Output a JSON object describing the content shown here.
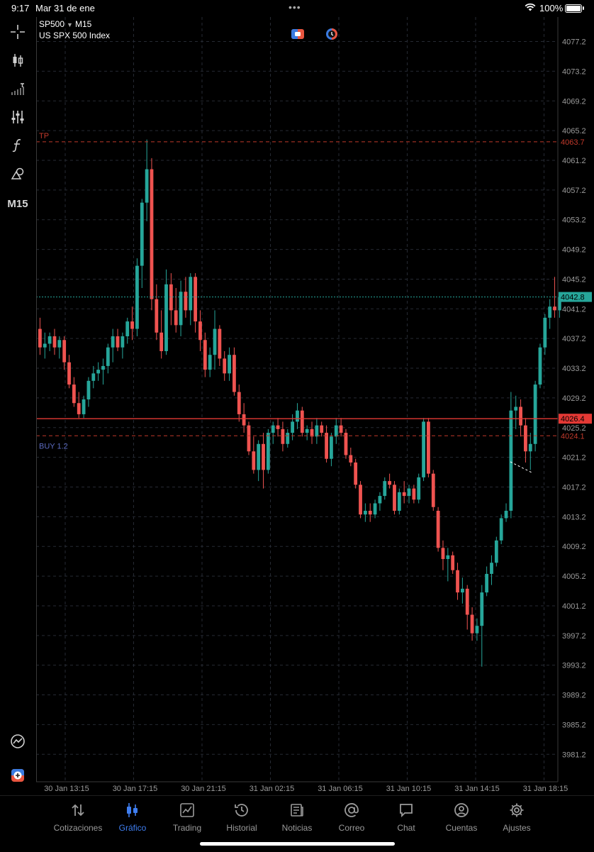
{
  "status_bar": {
    "time": "9:17",
    "date": "Mar 31 de ene",
    "battery": "100%"
  },
  "chart_header": {
    "symbol": "SP500",
    "timeframe": "M15",
    "description": "US SPX 500 Index"
  },
  "left_toolbar": {
    "items": [
      {
        "icon": "crosshair-icon"
      },
      {
        "icon": "candles-icon"
      },
      {
        "icon": "indicators-icon"
      },
      {
        "icon": "settings-sliders-icon"
      },
      {
        "icon": "function-icon"
      },
      {
        "icon": "objects-icon"
      }
    ],
    "timeframe_label": "M15"
  },
  "colors": {
    "bull": "#26a69a",
    "bear": "#ef5350",
    "grid": "#2a2a2a",
    "tab_active": "#3f7ef0",
    "tp": "#c0392b",
    "buy": "#5c6bc0"
  },
  "chart_data": {
    "type": "candlestick",
    "ylim": [
      3977.5,
      4080.5
    ],
    "y_ticks": [
      "4077.2",
      "4073.2",
      "4069.2",
      "4065.2",
      "4061.2",
      "4057.2",
      "4053.2",
      "4049.2",
      "4045.2",
      "4041.2",
      "4037.2",
      "4033.2",
      "4029.2",
      "4025.2",
      "4021.2",
      "4017.2",
      "4013.2",
      "4009.2",
      "4005.2",
      "4001.2",
      "3997.2",
      "3993.2",
      "3989.2",
      "3985.2",
      "3981.2"
    ],
    "x_ticks": [
      "30 Jan 13:15",
      "30 Jan 17:15",
      "30 Jan 21:15",
      "31 Jan 02:15",
      "31 Jan 06:15",
      "31 Jan 10:15",
      "31 Jan 14:15",
      "31 Jan 18:15"
    ],
    "levels": [
      {
        "label": "TP",
        "price": 4063.7,
        "price_label": "4063.7",
        "style": "dashed",
        "color": "#c0392b"
      },
      {
        "label": "BUY 1.2",
        "price": 4024.1,
        "price_label": "4024.1",
        "style": "dashed",
        "color": "#c0392b"
      },
      {
        "label": "",
        "price": 4026.4,
        "price_label": "4026.4",
        "style": "solid",
        "color": "#e53935"
      },
      {
        "label": "",
        "price": 4042.8,
        "price_label": "4042.8",
        "style": "dotted",
        "color": "#26a69a"
      }
    ],
    "candles": [
      [
        4038.5,
        4040.0,
        4035.0,
        4036.0
      ],
      [
        4036.0,
        4038.0,
        4034.5,
        4036.5
      ],
      [
        4036.5,
        4038.0,
        4035.5,
        4037.5
      ],
      [
        4037.5,
        4038.5,
        4035.0,
        4036.0
      ],
      [
        4036.0,
        4037.5,
        4034.5,
        4037.0
      ],
      [
        4037.0,
        4037.5,
        4033.0,
        4034.0
      ],
      [
        4034.0,
        4035.0,
        4030.5,
        4031.0
      ],
      [
        4031.0,
        4032.0,
        4028.0,
        4028.5
      ],
      [
        4028.5,
        4030.0,
        4026.5,
        4027.0
      ],
      [
        4027.0,
        4029.5,
        4026.5,
        4029.0
      ],
      [
        4029.0,
        4032.0,
        4028.0,
        4031.5
      ],
      [
        4031.5,
        4033.5,
        4030.5,
        4032.5
      ],
      [
        4032.5,
        4034.0,
        4031.5,
        4033.0
      ],
      [
        4033.0,
        4034.5,
        4031.0,
        4033.5
      ],
      [
        4033.5,
        4036.5,
        4032.5,
        4036.0
      ],
      [
        4036.0,
        4038.5,
        4034.0,
        4037.5
      ],
      [
        4037.5,
        4038.5,
        4035.5,
        4036.0
      ],
      [
        4036.0,
        4038.0,
        4034.5,
        4037.5
      ],
      [
        4037.5,
        4040.0,
        4036.5,
        4039.5
      ],
      [
        4039.5,
        4041.5,
        4037.0,
        4038.5
      ],
      [
        4038.5,
        4048.0,
        4037.5,
        4047.0
      ],
      [
        4047.0,
        4056.0,
        4044.0,
        4055.5
      ],
      [
        4055.5,
        4064.0,
        4053.0,
        4060.0
      ],
      [
        4060.0,
        4061.5,
        4041.0,
        4042.5
      ],
      [
        4042.5,
        4044.5,
        4037.0,
        4038.0
      ],
      [
        4038.0,
        4041.0,
        4034.5,
        4035.5
      ],
      [
        4035.5,
        4046.5,
        4035.0,
        4044.5
      ],
      [
        4044.5,
        4046.0,
        4039.0,
        4041.0
      ],
      [
        4041.0,
        4044.0,
        4038.0,
        4039.0
      ],
      [
        4039.0,
        4045.0,
        4037.5,
        4043.5
      ],
      [
        4043.5,
        4045.5,
        4040.0,
        4041.0
      ],
      [
        4041.0,
        4046.0,
        4039.0,
        4045.5
      ],
      [
        4045.5,
        4046.0,
        4038.0,
        4039.5
      ],
      [
        4039.5,
        4041.0,
        4035.5,
        4037.0
      ],
      [
        4037.0,
        4038.0,
        4032.0,
        4033.0
      ],
      [
        4033.0,
        4036.0,
        4032.0,
        4035.0
      ],
      [
        4035.0,
        4041.0,
        4033.0,
        4038.5
      ],
      [
        4038.5,
        4039.0,
        4033.5,
        4034.5
      ],
      [
        4034.5,
        4035.5,
        4031.5,
        4032.5
      ],
      [
        4032.5,
        4036.0,
        4031.5,
        4035.0
      ],
      [
        4035.0,
        4036.0,
        4029.5,
        4030.0
      ],
      [
        4030.0,
        4031.0,
        4026.0,
        4027.0
      ],
      [
        4027.0,
        4028.5,
        4024.5,
        4025.5
      ],
      [
        4025.5,
        4026.0,
        4021.5,
        4022.0
      ],
      [
        4022.0,
        4024.0,
        4019.0,
        4019.5
      ],
      [
        4019.5,
        4023.5,
        4018.0,
        4023.0
      ],
      [
        4023.0,
        4024.5,
        4017.0,
        4019.5
      ],
      [
        4019.5,
        4025.0,
        4019.0,
        4024.5
      ],
      [
        4024.5,
        4026.0,
        4023.0,
        4025.5
      ],
      [
        4025.5,
        4026.5,
        4024.0,
        4025.0
      ],
      [
        4025.0,
        4026.0,
        4022.0,
        4023.0
      ],
      [
        4023.0,
        4025.0,
        4022.5,
        4024.5
      ],
      [
        4024.5,
        4027.0,
        4023.5,
        4026.0
      ],
      [
        4026.0,
        4028.5,
        4025.0,
        4027.5
      ],
      [
        4027.5,
        4028.0,
        4024.0,
        4024.5
      ],
      [
        4024.5,
        4025.5,
        4023.5,
        4025.0
      ],
      [
        4025.0,
        4026.0,
        4023.0,
        4024.0
      ],
      [
        4024.0,
        4026.5,
        4023.0,
        4025.5
      ],
      [
        4025.5,
        4026.0,
        4024.0,
        4024.5
      ],
      [
        4024.5,
        4025.5,
        4020.5,
        4021.0
      ],
      [
        4021.0,
        4024.5,
        4020.0,
        4024.0
      ],
      [
        4024.0,
        4026.5,
        4023.0,
        4025.5
      ],
      [
        4025.5,
        4026.5,
        4024.0,
        4024.5
      ],
      [
        4024.5,
        4025.0,
        4021.0,
        4021.5
      ],
      [
        4021.5,
        4022.5,
        4020.0,
        4020.5
      ],
      [
        4020.5,
        4021.0,
        4017.0,
        4017.5
      ],
      [
        4017.5,
        4018.0,
        4013.0,
        4013.5
      ],
      [
        4013.5,
        4015.0,
        4012.5,
        4014.0
      ],
      [
        4014.0,
        4015.0,
        4012.5,
        4013.5
      ],
      [
        4013.5,
        4015.5,
        4013.0,
        4015.0
      ],
      [
        4015.0,
        4016.5,
        4014.0,
        4016.0
      ],
      [
        4016.0,
        4018.5,
        4015.5,
        4018.0
      ],
      [
        4018.0,
        4019.0,
        4017.0,
        4017.5
      ],
      [
        4017.5,
        4018.0,
        4013.5,
        4014.0
      ],
      [
        4014.0,
        4017.0,
        4013.5,
        4016.5
      ],
      [
        4016.5,
        4018.0,
        4015.0,
        4016.0
      ],
      [
        4016.0,
        4017.5,
        4015.0,
        4017.0
      ],
      [
        4017.0,
        4017.5,
        4015.0,
        4015.5
      ],
      [
        4015.5,
        4019.0,
        4015.0,
        4018.5
      ],
      [
        4018.5,
        4026.5,
        4018.0,
        4026.0
      ],
      [
        4026.0,
        4026.5,
        4018.5,
        4019.0
      ],
      [
        4019.0,
        4019.5,
        4014.0,
        4014.5
      ],
      [
        4014.0,
        4014.5,
        4008.5,
        4009.0
      ],
      [
        4009.0,
        4010.0,
        4006.0,
        4007.5
      ],
      [
        4007.5,
        4009.0,
        4004.5,
        4008.0
      ],
      [
        4008.0,
        4008.5,
        4005.5,
        4006.0
      ],
      [
        4006.0,
        4007.0,
        4002.0,
        4003.0
      ],
      [
        4003.0,
        4005.0,
        4001.5,
        4003.5
      ],
      [
        4003.5,
        4004.0,
        3998.0,
        4000.0
      ],
      [
        4000.0,
        4001.0,
        3996.5,
        3997.5
      ],
      [
        3997.5,
        3999.5,
        3996.5,
        3998.5
      ],
      [
        3998.5,
        4004.0,
        3993.0,
        4003.0
      ],
      [
        4003.0,
        4006.5,
        4002.5,
        4005.5
      ],
      [
        4005.5,
        4008.0,
        4004.0,
        4007.0
      ],
      [
        4007.0,
        4010.5,
        4006.5,
        4010.0
      ],
      [
        4010.0,
        4013.5,
        4009.5,
        4013.0
      ],
      [
        4013.0,
        4015.0,
        4012.5,
        4014.0
      ],
      [
        4014.0,
        4030.0,
        4013.0,
        4027.5
      ],
      [
        4027.5,
        4029.5,
        4025.0,
        4028.0
      ],
      [
        4028.0,
        4029.0,
        4024.0,
        4025.5
      ],
      [
        4025.5,
        4026.5,
        4020.5,
        4022.0
      ],
      [
        4022.0,
        4024.5,
        4019.5,
        4023.0
      ],
      [
        4023.0,
        4031.5,
        4022.0,
        4031.0
      ],
      [
        4031.0,
        4036.5,
        4030.5,
        4036.0
      ],
      [
        4036.0,
        4040.5,
        4035.0,
        4040.0
      ],
      [
        4040.0,
        4042.5,
        4038.5,
        4041.5
      ],
      [
        4041.5,
        4045.5,
        4040.0,
        4041.0
      ],
      [
        4041.0,
        4043.0,
        4040.0,
        4042.8
      ]
    ]
  },
  "tabbar": {
    "tabs": [
      {
        "label": "Cotizaciones",
        "icon": "arrows-updown-icon",
        "active": false
      },
      {
        "label": "Gráfico",
        "icon": "chart-candles-icon",
        "active": true
      },
      {
        "label": "Trading",
        "icon": "trading-chart-icon",
        "active": false
      },
      {
        "label": "Historial",
        "icon": "history-clock-icon",
        "active": false
      },
      {
        "label": "Noticias",
        "icon": "newspaper-icon",
        "active": false
      },
      {
        "label": "Correo",
        "icon": "at-icon",
        "active": false
      },
      {
        "label": "Chat",
        "icon": "chat-bubble-icon",
        "active": false
      },
      {
        "label": "Cuentas",
        "icon": "account-icon",
        "active": false
      },
      {
        "label": "Ajustes",
        "icon": "gear-icon",
        "active": false
      }
    ]
  }
}
